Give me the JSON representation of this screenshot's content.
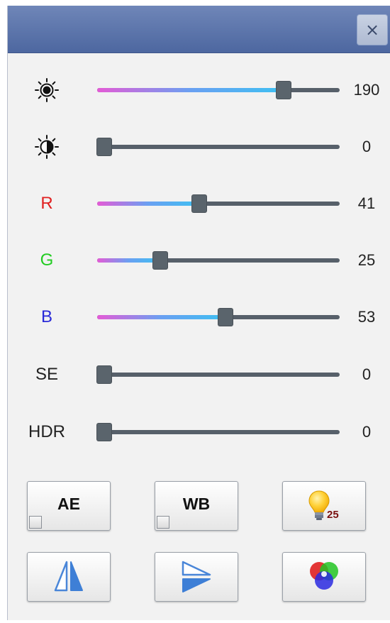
{
  "window": {
    "close_glyph": "×"
  },
  "sliders": [
    {
      "id": "brightness",
      "icon": "brightness-icon",
      "value": "190",
      "fraction": 0.77,
      "has_fill": true
    },
    {
      "id": "contrast",
      "icon": "contrast-icon",
      "value": "0",
      "fraction": 0.0,
      "has_fill": false
    },
    {
      "id": "red",
      "label": "R",
      "label_color": "#e02020",
      "value": "41",
      "fraction": 0.42,
      "has_fill": true
    },
    {
      "id": "green",
      "label": "G",
      "label_color": "#22cc22",
      "value": "25",
      "fraction": 0.26,
      "has_fill": true
    },
    {
      "id": "blue",
      "label": "B",
      "label_color": "#2a2ad8",
      "value": "53",
      "fraction": 0.53,
      "has_fill": true
    },
    {
      "id": "se",
      "label": "SE",
      "label_color": "#222222",
      "value": "0",
      "fraction": 0.0,
      "has_fill": false
    },
    {
      "id": "hdr",
      "label": "HDR",
      "label_color": "#222222",
      "value": "0",
      "fraction": 0.0,
      "has_fill": false
    }
  ],
  "buttons": {
    "ae": {
      "label": "AE",
      "checked": false
    },
    "wb": {
      "label": "WB",
      "checked": false
    },
    "light": {
      "icon": "light-bulb-icon",
      "count": "25"
    },
    "flip_horizontal": {
      "icon": "flip-horizontal-icon"
    },
    "flip_vertical": {
      "icon": "flip-vertical-icon"
    },
    "color": {
      "icon": "rgb-circles-icon"
    }
  },
  "colors": {
    "titlebar": "#5a72a8",
    "slider_fill_start": "#e45bd6",
    "slider_fill_end": "#3ec0f2",
    "slider_track": "#57606a"
  }
}
